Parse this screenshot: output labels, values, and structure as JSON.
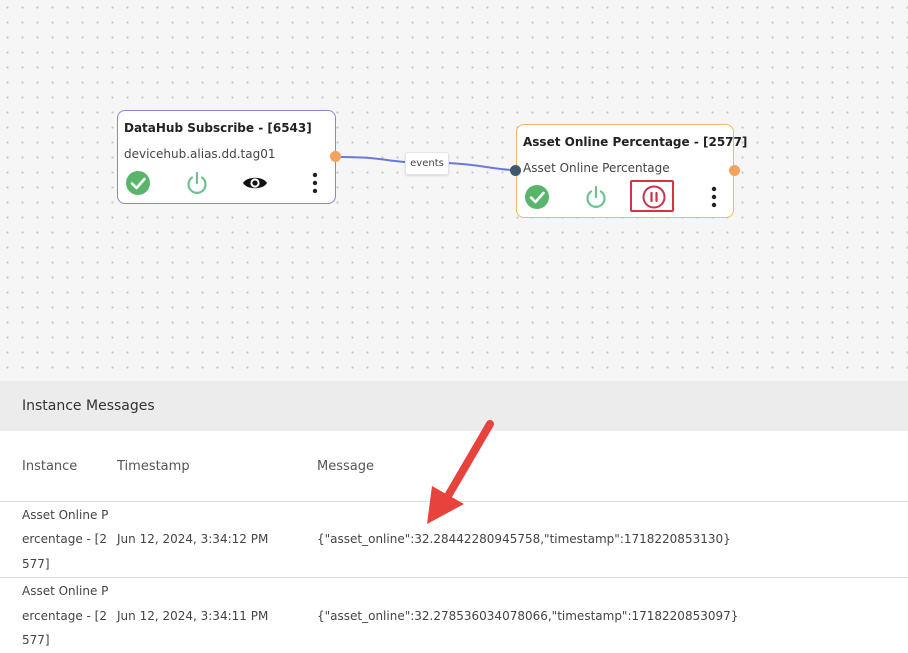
{
  "canvas": {
    "nodes": [
      {
        "title": "DataHub Subscribe - [6543]",
        "subtitle": "devicehub.alias.dd.tag01",
        "icons": [
          "check-circle-icon",
          "power-icon",
          "eye-icon",
          "more-vertical-icon"
        ]
      },
      {
        "title": "Asset Online Percentage - [2577]",
        "subtitle": "Asset Online Percentage",
        "icons": [
          "check-circle-icon",
          "power-icon",
          "pause-circle-icon",
          "more-vertical-icon"
        ]
      }
    ],
    "edge_label": "events"
  },
  "panel": {
    "title": "Instance Messages",
    "columns": [
      "Instance",
      "Timestamp",
      "Message"
    ],
    "rows": [
      {
        "instance_lines": [
          "Asset Online P",
          "ercentage - [2",
          "577]"
        ],
        "timestamp": "Jun 12, 2024, 3:34:12 PM",
        "message": "{\"asset_online\":32.28442280945758,\"timestamp\":1718220853130}"
      },
      {
        "instance_lines": [
          "Asset Online P",
          "ercentage - [2",
          "577]"
        ],
        "timestamp": "Jun 12, 2024, 3:34:11 PM",
        "message": "{\"asset_online\":32.278536034078066,\"timestamp\":1718220853097}"
      }
    ]
  },
  "colors": {
    "check_green": "#58b56a",
    "power_green": "#6cc18f",
    "pause_red": "#c8324a",
    "highlight_red": "#d7323f",
    "arrow_red": "#e8423d",
    "edge_blue": "#6b78dd"
  }
}
